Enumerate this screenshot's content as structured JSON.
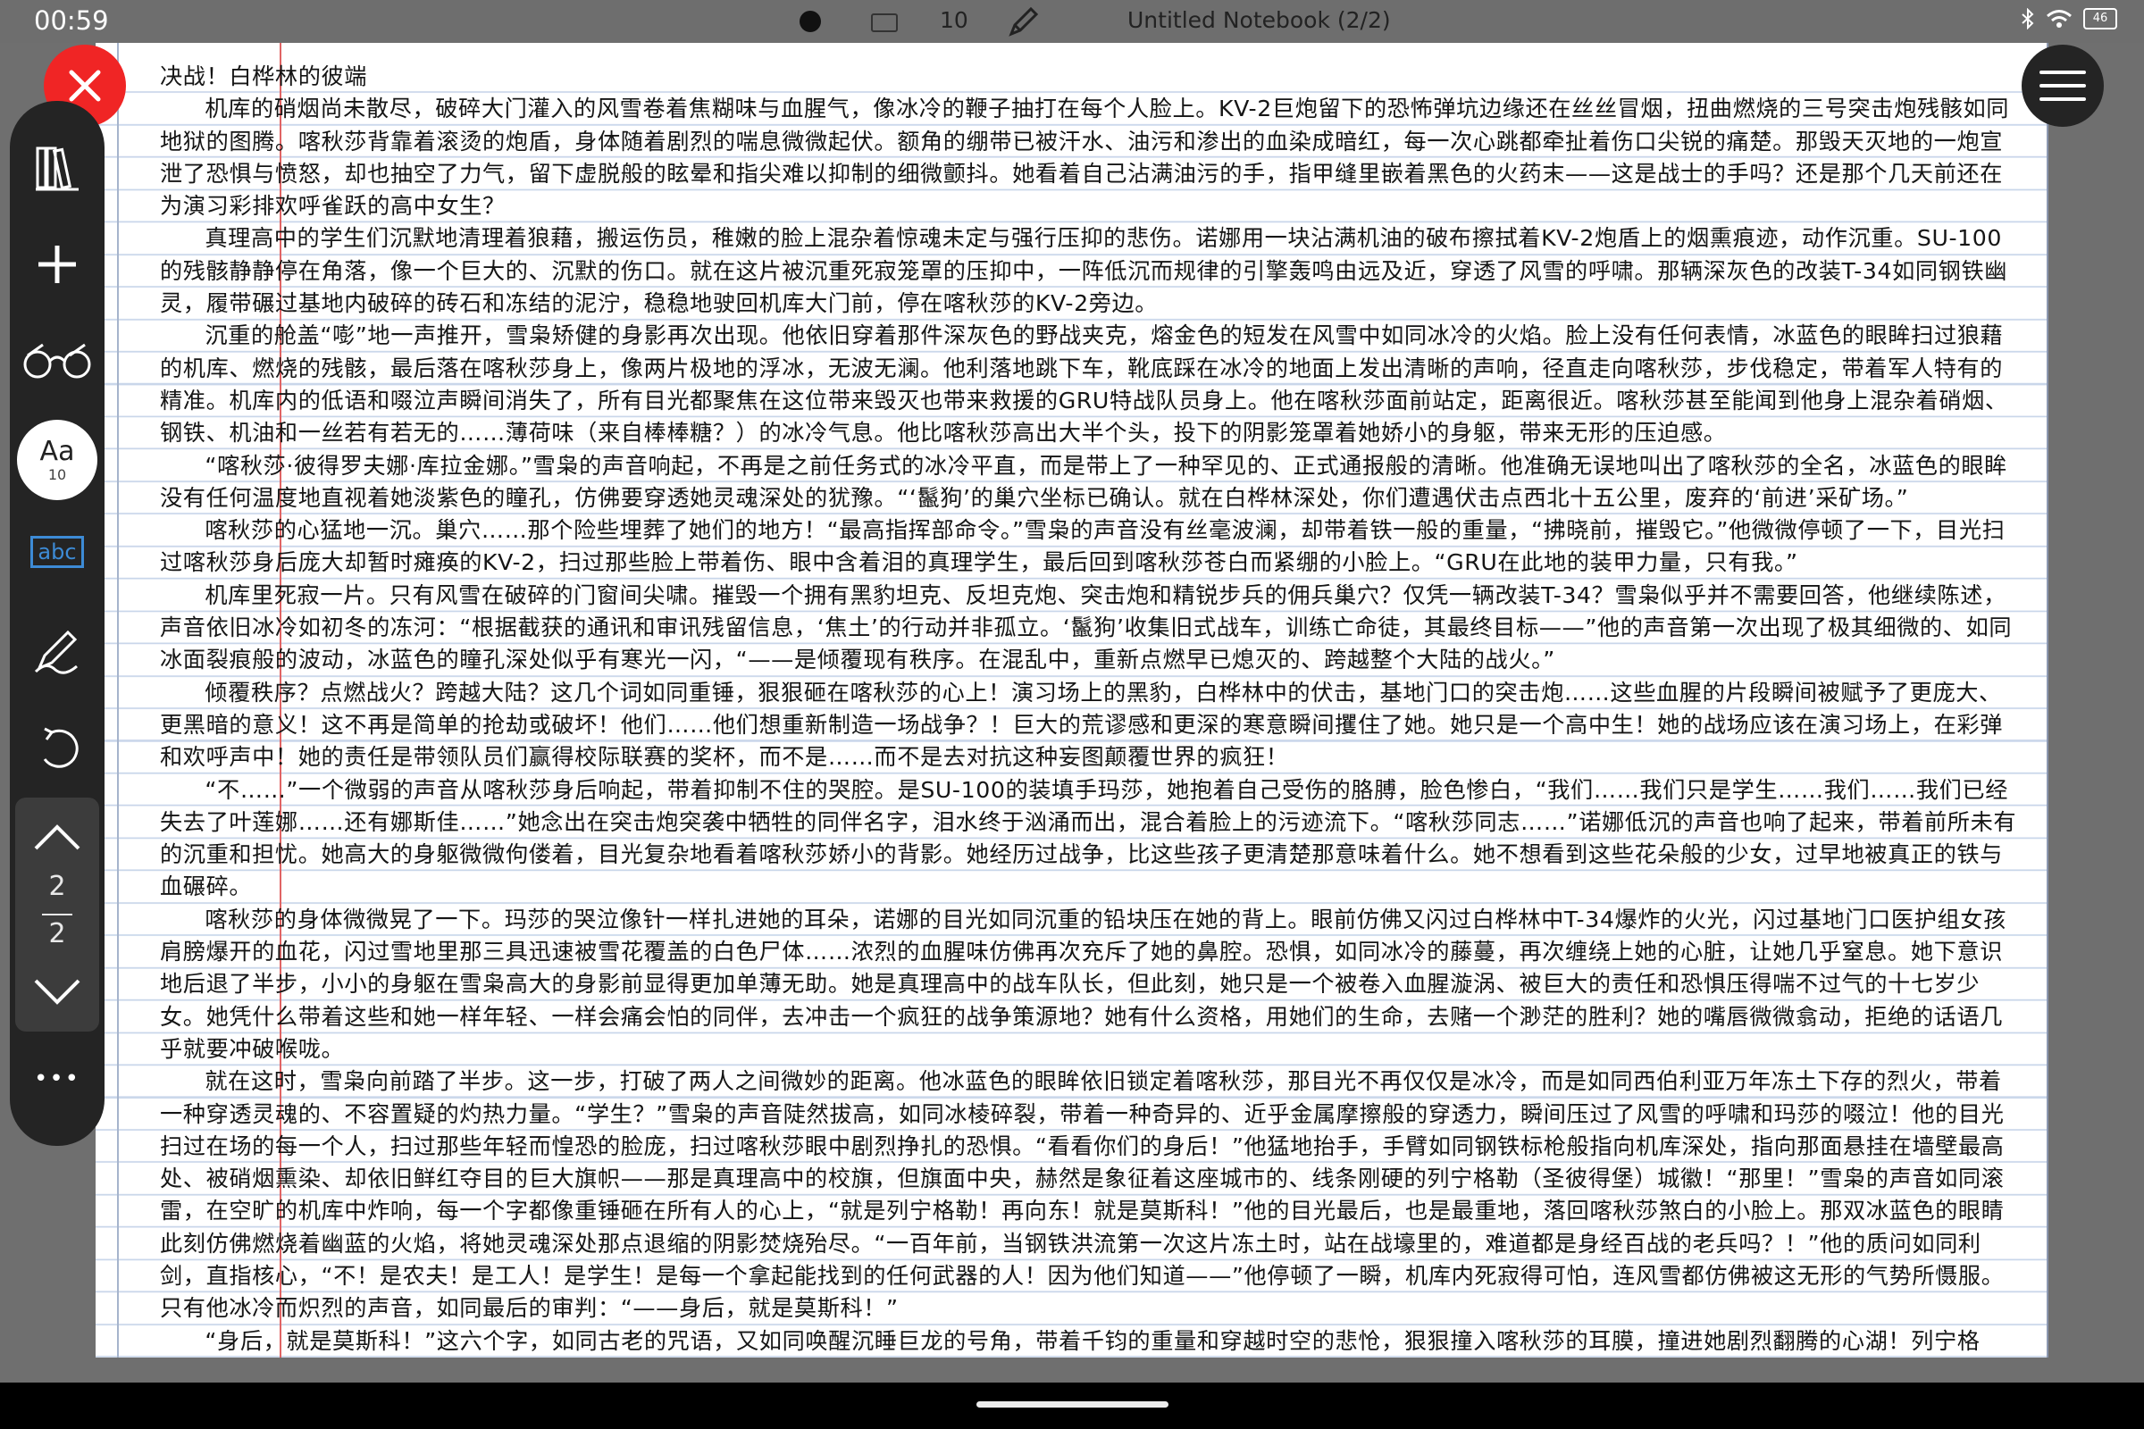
{
  "status_bar": {
    "time": "00:59",
    "pen_size": "10",
    "notebook_title": "Untitled Notebook (2/2)",
    "battery": "46"
  },
  "toolbar": {
    "font_label": "Aa",
    "font_size": "10",
    "text_tool_label": "abc",
    "page_current": "2",
    "page_total": "2",
    "more_label": "•••"
  },
  "colors": {
    "close": "#f02525",
    "toolbar": "#242424",
    "margin_line": "#e06464",
    "ruled_line": "#c9d6ea",
    "text_tool": "#3d8bd6"
  },
  "notebook": {
    "title": "决战！白桦林的彼端",
    "paragraphs": [
      "机库的硝烟尚未散尽，破碎大门灌入的风雪卷着焦糊味与血腥气，像冰冷的鞭子抽打在每个人脸上。KV-2巨炮留下的恐怖弹坑边缘还在丝丝冒烟，扭曲燃烧的三号突击炮残骸如同地狱的图腾。喀秋莎背靠着滚烫的炮盾，身体随着剧烈的喘息微微起伏。额角的绷带已被汗水、油污和渗出的血染成暗红，每一次心跳都牵扯着伤口尖锐的痛楚。那毁天灭地的一炮宣泄了恐惧与愤怒，却也抽空了力气，留下虚脱般的眩晕和指尖难以抑制的细微颤抖。她看着自己沾满油污的手，指甲缝里嵌着黑色的火药末——这是战士的手吗？还是那个几天前还在为演习彩排欢呼雀跃的高中女生？",
      "真理高中的学生们沉默地清理着狼藉，搬运伤员，稚嫩的脸上混杂着惊魂未定与强行压抑的悲伤。诺娜用一块沾满机油的破布擦拭着KV-2炮盾上的烟熏痕迹，动作沉重。SU-100的残骸静静停在角落，像一个巨大的、沉默的伤口。就在这片被沉重死寂笼罩的压抑中，一阵低沉而规律的引擎轰鸣由远及近，穿透了风雪的呼啸。那辆深灰色的改装T-34如同钢铁幽灵，履带碾过基地内破碎的砖石和冻结的泥泞，稳稳地驶回机库大门前，停在喀秋莎的KV-2旁边。",
      "沉重的舱盖“嘭”地一声推开，雪枭矫健的身影再次出现。他依旧穿着那件深灰色的野战夹克，熔金色的短发在风雪中如同冰冷的火焰。脸上没有任何表情，冰蓝色的眼眸扫过狼藉的机库、燃烧的残骸，最后落在喀秋莎身上，像两片极地的浮冰，无波无澜。他利落地跳下车，靴底踩在冰冷的地面上发出清晰的声响，径直走向喀秋莎，步伐稳定，带着军人特有的精准。机库内的低语和啜泣声瞬间消失了，所有目光都聚焦在这位带来毁灭也带来救援的GRU特战队员身上。他在喀秋莎面前站定，距离很近。喀秋莎甚至能闻到他身上混杂着硝烟、钢铁、机油和一丝若有若无的……薄荷味（来自棒棒糖？）的冰冷气息。他比喀秋莎高出大半个头，投下的阴影笼罩着她娇小的身躯，带来无形的压迫感。",
      "“喀秋莎·彼得罗夫娜·库拉金娜。”雪枭的声音响起，不再是之前任务式的冰冷平直，而是带上了一种罕见的、正式通报般的清晰。他准确无误地叫出了喀秋莎的全名，冰蓝色的眼眸没有任何温度地直视着她淡紫色的瞳孔，仿佛要穿透她灵魂深处的犹豫。“‘鬣狗’的巢穴坐标已确认。就在白桦林深处，你们遭遇伏击点西北十五公里，废弃的‘前进’采矿场。”",
      "喀秋莎的心猛地一沉。巢穴……那个险些埋葬了她们的地方！“最高指挥部命令。”雪枭的声音没有丝毫波澜，却带着铁一般的重量，“拂晓前，摧毁它。”他微微停顿了一下，目光扫过喀秋莎身后庞大却暂时瘫痪的KV-2，扫过那些脸上带着伤、眼中含着泪的真理学生，最后回到喀秋莎苍白而紧绷的小脸上。“GRU在此地的装甲力量，只有我。”",
      "机库里死寂一片。只有风雪在破碎的门窗间尖啸。摧毁一个拥有黑豹坦克、反坦克炮、突击炮和精锐步兵的佣兵巢穴？仅凭一辆改装T-34？雪枭似乎并不需要回答，他继续陈述，声音依旧冰冷如初冬的冻河：“根据截获的通讯和审讯残留信息，‘焦土’的行动并非孤立。‘鬣狗’收集旧式战车，训练亡命徒，其最终目标——”他的声音第一次出现了极其细微的、如同冰面裂痕般的波动，冰蓝色的瞳孔深处似乎有寒光一闪，“——是倾覆现有秩序。在混乱中，重新点燃早已熄灭的、跨越整个大陆的战火。”",
      "倾覆秩序？点燃战火？跨越大陆？这几个词如同重锤，狠狠砸在喀秋莎的心上！演习场上的黑豹，白桦林中的伏击，基地门口的突击炮……这些血腥的片段瞬间被赋予了更庞大、更黑暗的意义！这不再是简单的抢劫或破坏！他们……他们想重新制造一场战争？！巨大的荒谬感和更深的寒意瞬间攫住了她。她只是一个高中生！她的战场应该在演习场上，在彩弹和欢呼声中！她的责任是带领队员们赢得校际联赛的奖杯，而不是……而不是去对抗这种妄图颠覆世界的疯狂！",
      "“不……”一个微弱的声音从喀秋莎身后响起，带着抑制不住的哭腔。是SU-100的装填手玛莎，她抱着自己受伤的胳膊，脸色惨白，“我们……我们只是学生……我们……我们已经失去了叶莲娜……还有娜斯佳……”她念出在突击炮突袭中牺牲的同伴名字，泪水终于汹涌而出，混合着脸上的污迹流下。“喀秋莎同志……”诺娜低沉的声音也响了起来，带着前所未有的沉重和担忧。她高大的身躯微微佝偻着，目光复杂地看着喀秋莎娇小的背影。她经历过战争，比这些孩子更清楚那意味着什么。她不想看到这些花朵般的少女，过早地被真正的铁与血碾碎。",
      "喀秋莎的身体微微晃了一下。玛莎的哭泣像针一样扎进她的耳朵，诺娜的目光如同沉重的铅块压在她的背上。眼前仿佛又闪过白桦林中T-34爆炸的火光，闪过基地门口医护组女孩肩膀爆开的血花，闪过雪地里那三具迅速被雪花覆盖的白色尸体……浓烈的血腥味仿佛再次充斥了她的鼻腔。恐惧，如同冰冷的藤蔓，再次缠绕上她的心脏，让她几乎窒息。她下意识地后退了半步，小小的身躯在雪枭高大的身影前显得更加单薄无助。她是真理高中的战车队长，但此刻，她只是一个被卷入血腥漩涡、被巨大的责任和恐惧压得喘不过气的十七岁少女。她凭什么带着这些和她一样年轻、一样会痛会怕的同伴，去冲击一个疯狂的战争策源地？她有什么资格，用她们的生命，去赌一个渺茫的胜利？她的嘴唇微微翕动，拒绝的话语几乎就要冲破喉咙。",
      "就在这时，雪枭向前踏了半步。这一步，打破了两人之间微妙的距离。他冰蓝色的眼眸依旧锁定着喀秋莎，那目光不再仅仅是冰冷，而是如同西伯利亚万年冻土下存的烈火，带着一种穿透灵魂的、不容置疑的灼热力量。“学生？”雪枭的声音陡然拔高，如同冰棱碎裂，带着一种奇异的、近乎金属摩擦般的穿透力，瞬间压过了风雪的呼啸和玛莎的啜泣！他的目光扫过在场的每一个人，扫过那些年轻而惶恐的脸庞，扫过喀秋莎眼中剧烈挣扎的恐惧。“看看你们的身后！”他猛地抬手，手臂如同钢铁标枪般指向机库深处，指向那面悬挂在墙壁最高处、被硝烟熏染、却依旧鲜红夺目的巨大旗帜——那是真理高中的校旗，但旗面中央，赫然是象征着这座城市的、线条刚硬的列宁格勒（圣彼得堡）城徽！“那里！”雪枭的声音如同滚雷，在空旷的机库中炸响，每一个字都像重锤砸在所有人的心上，“就是列宁格勒！再向东！就是莫斯科！”他的目光最后，也是最重地，落回喀秋莎煞白的小脸上。那双冰蓝色的眼睛此刻仿佛燃烧着幽蓝的火焰，将她灵魂深处那点退缩的阴影焚烧殆尽。“一百年前，当钢铁洪流第一次这片冻土时，站在战壕里的，难道都是身经百战的老兵吗？！”他的质问如同利剑，直指核心，“不！是农夫！是工人！是学生！是每一个拿起能找到的任何武器的人！因为他们知道——”他停顿了一瞬，机库内死寂得可怕，连风雪都仿佛被这无形的气势所慑服。只有他冰冷而炽烈的声音，如同最后的审判：“——身后，就是莫斯科！”",
      "“身后，就是莫斯科！”这六个字，如同古老的咒语，又如同唤醒沉睡巨龙的号角，带着千钧的重量和穿越时空的悲怆，狠狠撞入喀秋莎的耳膜，撞进她剧烈翻腾的心湖！列宁格勒……莫斯科……不再是遥远地理课本上的名词。它们是脚下这片土地流淌的血脉，是冻土下无数先辈的骸骨堆砌的基石，是风雪中永不熄灭的灯塔！一百年前？不！那场战争的余"
    ]
  }
}
